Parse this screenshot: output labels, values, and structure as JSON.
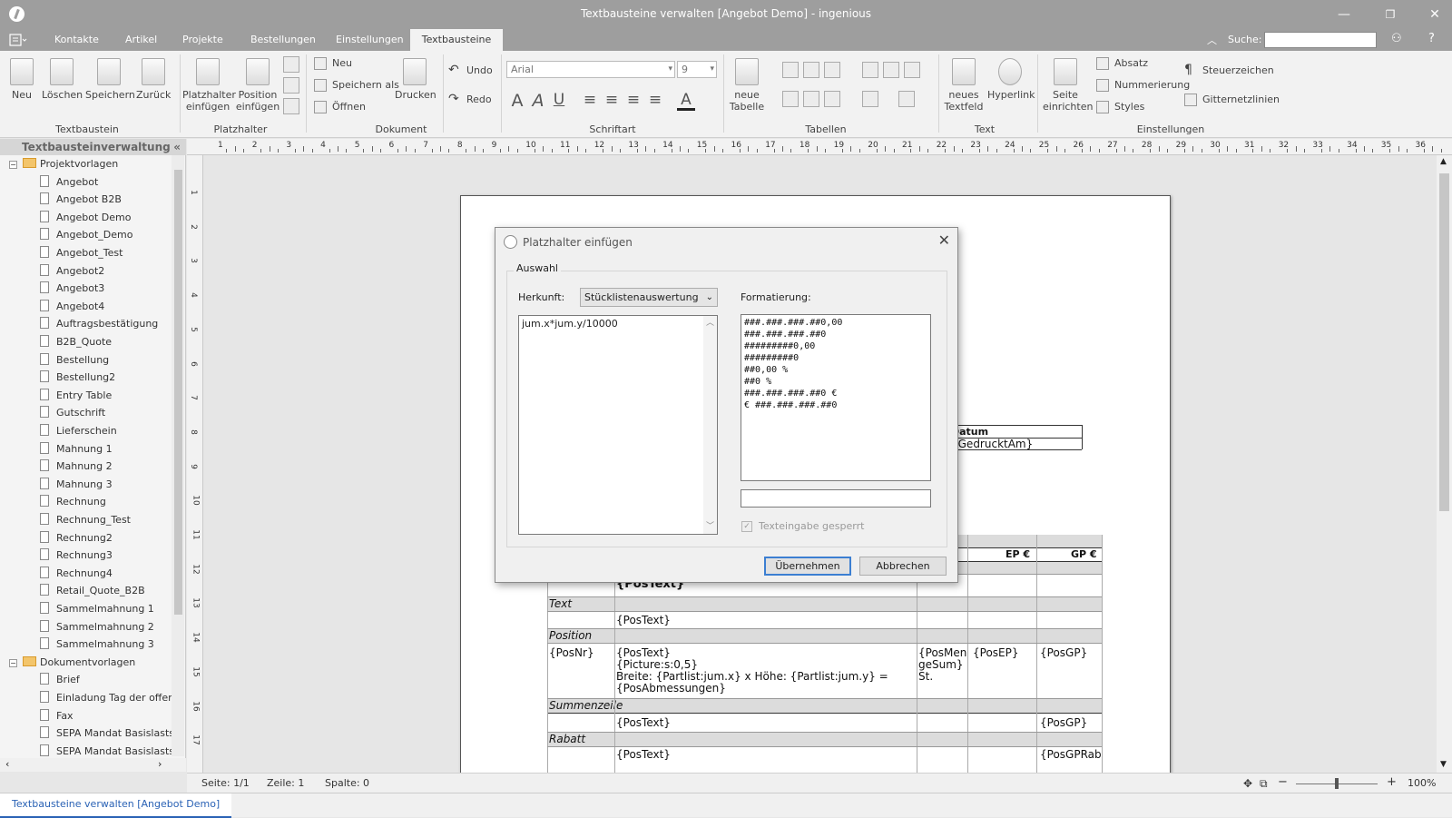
{
  "window": {
    "title": "Textbausteine verwalten [Angebot Demo] - ingenious",
    "minimize": "—",
    "restore": "❐",
    "close": "✕"
  },
  "tabs": [
    "Kontakte",
    "Artikel",
    "Projekte",
    "Bestellungen",
    "Einstellungen",
    "Textbausteine"
  ],
  "active_tab": "Textbausteine",
  "search": {
    "label": "Suche:",
    "value": ""
  },
  "ribbon": {
    "textbaustein": {
      "label": "Textbaustein",
      "neu": "Neu",
      "loeschen": "Löschen",
      "speichern": "Speichern",
      "zurueck": "Zurück"
    },
    "platzhalter": {
      "label": "Platzhalter",
      "einfuegen": "Platzhalter einfügen",
      "position": "Position einfügen"
    },
    "dokument": {
      "label": "Dokument",
      "neu": "Neu",
      "speichern_als": "Speichern als",
      "oeffnen": "Öffnen",
      "drucken": "Drucken"
    },
    "undo": "Undo",
    "redo": "Redo",
    "schriftart": {
      "label": "Schriftart",
      "font": "Arial",
      "size": "9"
    },
    "tabellen": {
      "label": "Tabellen",
      "neue_tabelle": "neue Tabelle"
    },
    "text": {
      "label": "Text",
      "textfeld": "neues Textfeld",
      "hyperlink": "Hyperlink"
    },
    "einstellungen": {
      "label": "Einstellungen",
      "seite": "Seite einrichten",
      "absatz": "Absatz",
      "nummerierung": "Nummerierung",
      "styles": "Styles",
      "steuerzeichen": "Steuerzeichen",
      "gitternetzlinien": "Gitternetzlinien"
    }
  },
  "sidebar": {
    "title": "Textbausteinverwaltung",
    "folders": [
      {
        "name": "Projektvorlagen",
        "items": [
          "Angebot",
          "Angebot B2B",
          "Angebot Demo",
          "Angebot_Demo",
          "Angebot_Test",
          "Angebot2",
          "Angebot3",
          "Angebot4",
          "Auftragsbestätigung",
          "B2B_Quote",
          "Bestellung",
          "Bestellung2",
          "Entry Table",
          "Gutschrift",
          "Lieferschein",
          "Mahnung 1",
          "Mahnung 2",
          "Mahnung 3",
          "Rechnung",
          "Rechnung_Test",
          "Rechnung2",
          "Rechnung3",
          "Rechnung4",
          "Retail_Quote_B2B",
          "Sammelmahnung 1",
          "Sammelmahnung 2",
          "Sammelmahnung 3"
        ]
      },
      {
        "name": "Dokumentvorlagen",
        "items": [
          "Brief",
          "Einladung Tag der offenen",
          "Fax",
          "SEPA Mandat Basislastsch",
          "SEPA Mandat Basislastsch"
        ]
      }
    ]
  },
  "ruler_numbers": [
    "1",
    "2",
    "3",
    "4",
    "5",
    "6",
    "7",
    "8",
    "9",
    "10",
    "11",
    "12",
    "13",
    "14",
    "15",
    "16",
    "17",
    "18",
    "19",
    "20",
    "21",
    "22",
    "23",
    "24",
    "25",
    "26",
    "27",
    "28",
    "29",
    "30",
    "31",
    "32",
    "33",
    "34",
    "35",
    "36"
  ],
  "document": {
    "datum_header": "Datum",
    "datum_value": "{GedrucktAm}",
    "col_menge": "ge",
    "col_ep": "EP €",
    "col_gp": "GP €",
    "rows": {
      "postext_bold": "{PosText}",
      "text_label": "Text",
      "text_postext": "{PosText}",
      "position_label": "Position",
      "posnr": "{PosNr}",
      "pos_line1": "{PosText}",
      "pos_line2": "{Picture:s:0,5}",
      "pos_line3": "Breite: {Partlist:jum.x} x Höhe: {Partlist:jum.y} =",
      "pos_line4": "{PosAbmessungen}",
      "menge_line1": "{PosMen",
      "menge_line2": "geSum}",
      "menge_line3": "St.",
      "posep": "{PosEP}",
      "posgp": "{PosGP}",
      "summen_label": "Summenzeile",
      "summen_postext": "{PosText}",
      "summen_gp": "{PosGP}",
      "rabatt_label": "Rabatt",
      "rabatt_postext": "{PosText}",
      "rabatt_gp": "{PosGPRab"
    }
  },
  "status": {
    "seite": "Seite: 1/1",
    "zeile": "Zeile: 1",
    "spalte": "Spalte: 0",
    "zoom": "100%"
  },
  "doc_tab": "Textbausteine verwalten [Angebot Demo]",
  "dialog": {
    "title": "Platzhalter einfügen",
    "group": "Auswahl",
    "herkunft_label": "Herkunft:",
    "herkunft_value": "Stücklistenauswertung",
    "expression": "jum.x*jum.y/10000",
    "formatierung_label": "Formatierung:",
    "formats": [
      "###.###.###.##0,00",
      "###.###.###.##0",
      "#########0,00",
      "#########0",
      "##0,00 %",
      "##0 %",
      "###.###.###.##0 €",
      "€ ###.###.###.##0"
    ],
    "format_input": "",
    "locked_label": "Texteingabe gesperrt",
    "ok": "Übernehmen",
    "cancel": "Abbrechen"
  }
}
